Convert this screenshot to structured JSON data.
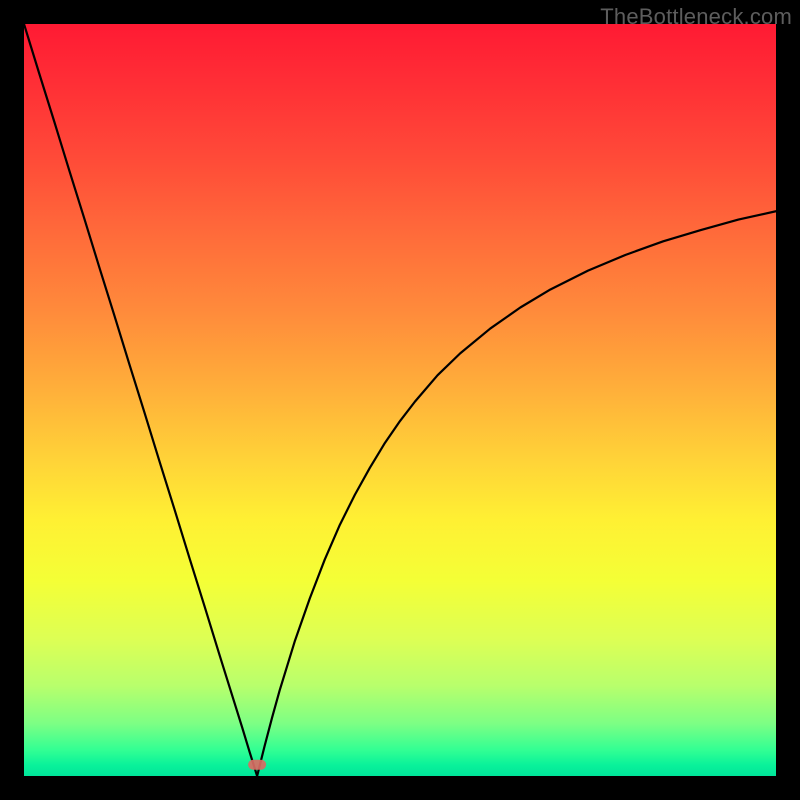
{
  "watermark": "TheBottleneck.com",
  "chart_data": {
    "type": "line",
    "title": "",
    "xlabel": "",
    "ylabel": "",
    "xlim": [
      0,
      100
    ],
    "ylim": [
      0,
      100
    ],
    "optimum_x": 31,
    "marker": {
      "x": 31,
      "y": 1.5,
      "color": "#d96b63"
    },
    "series": [
      {
        "name": "bottleneck-curve",
        "x": [
          0,
          2,
          4,
          6,
          8,
          10,
          12,
          14,
          16,
          18,
          20,
          22,
          24,
          26,
          28,
          29,
          30,
          31,
          32,
          33,
          34,
          36,
          38,
          40,
          42,
          44,
          46,
          48,
          50,
          52,
          55,
          58,
          62,
          66,
          70,
          75,
          80,
          85,
          90,
          95,
          100
        ],
        "values": [
          100,
          93.5,
          87.1,
          80.6,
          74.2,
          67.7,
          61.3,
          54.8,
          48.4,
          41.9,
          35.5,
          29.0,
          22.6,
          16.1,
          9.7,
          6.5,
          3.2,
          0.0,
          4.0,
          7.8,
          11.4,
          17.9,
          23.6,
          28.8,
          33.4,
          37.4,
          41.0,
          44.3,
          47.2,
          49.8,
          53.3,
          56.2,
          59.5,
          62.3,
          64.7,
          67.2,
          69.3,
          71.1,
          72.6,
          74.0,
          75.1
        ]
      }
    ],
    "background": {
      "type": "vertical-gradient",
      "stops": [
        {
          "pos": 0.0,
          "color": "#ff1a33"
        },
        {
          "pos": 0.08,
          "color": "#ff2f36"
        },
        {
          "pos": 0.18,
          "color": "#ff4b38"
        },
        {
          "pos": 0.28,
          "color": "#ff6b3a"
        },
        {
          "pos": 0.38,
          "color": "#ff8a3b"
        },
        {
          "pos": 0.48,
          "color": "#ffad3a"
        },
        {
          "pos": 0.58,
          "color": "#ffd338"
        },
        {
          "pos": 0.66,
          "color": "#fff033"
        },
        {
          "pos": 0.74,
          "color": "#f4ff36"
        },
        {
          "pos": 0.82,
          "color": "#dcff55"
        },
        {
          "pos": 0.88,
          "color": "#b8ff6c"
        },
        {
          "pos": 0.93,
          "color": "#7dff84"
        },
        {
          "pos": 0.965,
          "color": "#33ff93"
        },
        {
          "pos": 0.985,
          "color": "#0af29a"
        },
        {
          "pos": 1.0,
          "color": "#00e59a"
        }
      ]
    }
  }
}
